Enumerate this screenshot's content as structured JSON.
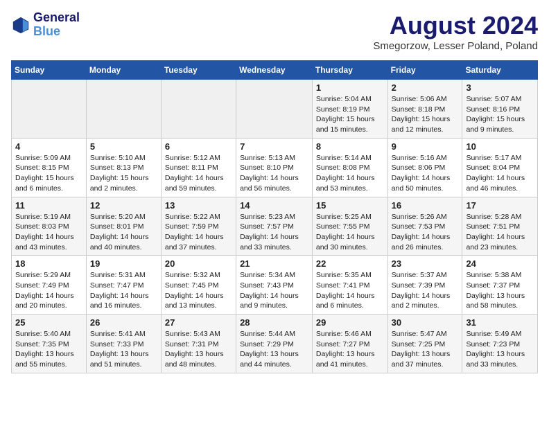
{
  "header": {
    "logo_line1": "General",
    "logo_line2": "Blue",
    "month_year": "August 2024",
    "location": "Smegorzow, Lesser Poland, Poland"
  },
  "days_of_week": [
    "Sunday",
    "Monday",
    "Tuesday",
    "Wednesday",
    "Thursday",
    "Friday",
    "Saturday"
  ],
  "weeks": [
    [
      {
        "day": "",
        "info": ""
      },
      {
        "day": "",
        "info": ""
      },
      {
        "day": "",
        "info": ""
      },
      {
        "day": "",
        "info": ""
      },
      {
        "day": "1",
        "info": "Sunrise: 5:04 AM\nSunset: 8:19 PM\nDaylight: 15 hours\nand 15 minutes."
      },
      {
        "day": "2",
        "info": "Sunrise: 5:06 AM\nSunset: 8:18 PM\nDaylight: 15 hours\nand 12 minutes."
      },
      {
        "day": "3",
        "info": "Sunrise: 5:07 AM\nSunset: 8:16 PM\nDaylight: 15 hours\nand 9 minutes."
      }
    ],
    [
      {
        "day": "4",
        "info": "Sunrise: 5:09 AM\nSunset: 8:15 PM\nDaylight: 15 hours\nand 6 minutes."
      },
      {
        "day": "5",
        "info": "Sunrise: 5:10 AM\nSunset: 8:13 PM\nDaylight: 15 hours\nand 2 minutes."
      },
      {
        "day": "6",
        "info": "Sunrise: 5:12 AM\nSunset: 8:11 PM\nDaylight: 14 hours\nand 59 minutes."
      },
      {
        "day": "7",
        "info": "Sunrise: 5:13 AM\nSunset: 8:10 PM\nDaylight: 14 hours\nand 56 minutes."
      },
      {
        "day": "8",
        "info": "Sunrise: 5:14 AM\nSunset: 8:08 PM\nDaylight: 14 hours\nand 53 minutes."
      },
      {
        "day": "9",
        "info": "Sunrise: 5:16 AM\nSunset: 8:06 PM\nDaylight: 14 hours\nand 50 minutes."
      },
      {
        "day": "10",
        "info": "Sunrise: 5:17 AM\nSunset: 8:04 PM\nDaylight: 14 hours\nand 46 minutes."
      }
    ],
    [
      {
        "day": "11",
        "info": "Sunrise: 5:19 AM\nSunset: 8:03 PM\nDaylight: 14 hours\nand 43 minutes."
      },
      {
        "day": "12",
        "info": "Sunrise: 5:20 AM\nSunset: 8:01 PM\nDaylight: 14 hours\nand 40 minutes."
      },
      {
        "day": "13",
        "info": "Sunrise: 5:22 AM\nSunset: 7:59 PM\nDaylight: 14 hours\nand 37 minutes."
      },
      {
        "day": "14",
        "info": "Sunrise: 5:23 AM\nSunset: 7:57 PM\nDaylight: 14 hours\nand 33 minutes."
      },
      {
        "day": "15",
        "info": "Sunrise: 5:25 AM\nSunset: 7:55 PM\nDaylight: 14 hours\nand 30 minutes."
      },
      {
        "day": "16",
        "info": "Sunrise: 5:26 AM\nSunset: 7:53 PM\nDaylight: 14 hours\nand 26 minutes."
      },
      {
        "day": "17",
        "info": "Sunrise: 5:28 AM\nSunset: 7:51 PM\nDaylight: 14 hours\nand 23 minutes."
      }
    ],
    [
      {
        "day": "18",
        "info": "Sunrise: 5:29 AM\nSunset: 7:49 PM\nDaylight: 14 hours\nand 20 minutes."
      },
      {
        "day": "19",
        "info": "Sunrise: 5:31 AM\nSunset: 7:47 PM\nDaylight: 14 hours\nand 16 minutes."
      },
      {
        "day": "20",
        "info": "Sunrise: 5:32 AM\nSunset: 7:45 PM\nDaylight: 14 hours\nand 13 minutes."
      },
      {
        "day": "21",
        "info": "Sunrise: 5:34 AM\nSunset: 7:43 PM\nDaylight: 14 hours\nand 9 minutes."
      },
      {
        "day": "22",
        "info": "Sunrise: 5:35 AM\nSunset: 7:41 PM\nDaylight: 14 hours\nand 6 minutes."
      },
      {
        "day": "23",
        "info": "Sunrise: 5:37 AM\nSunset: 7:39 PM\nDaylight: 14 hours\nand 2 minutes."
      },
      {
        "day": "24",
        "info": "Sunrise: 5:38 AM\nSunset: 7:37 PM\nDaylight: 13 hours\nand 58 minutes."
      }
    ],
    [
      {
        "day": "25",
        "info": "Sunrise: 5:40 AM\nSunset: 7:35 PM\nDaylight: 13 hours\nand 55 minutes."
      },
      {
        "day": "26",
        "info": "Sunrise: 5:41 AM\nSunset: 7:33 PM\nDaylight: 13 hours\nand 51 minutes."
      },
      {
        "day": "27",
        "info": "Sunrise: 5:43 AM\nSunset: 7:31 PM\nDaylight: 13 hours\nand 48 minutes."
      },
      {
        "day": "28",
        "info": "Sunrise: 5:44 AM\nSunset: 7:29 PM\nDaylight: 13 hours\nand 44 minutes."
      },
      {
        "day": "29",
        "info": "Sunrise: 5:46 AM\nSunset: 7:27 PM\nDaylight: 13 hours\nand 41 minutes."
      },
      {
        "day": "30",
        "info": "Sunrise: 5:47 AM\nSunset: 7:25 PM\nDaylight: 13 hours\nand 37 minutes."
      },
      {
        "day": "31",
        "info": "Sunrise: 5:49 AM\nSunset: 7:23 PM\nDaylight: 13 hours\nand 33 minutes."
      }
    ]
  ]
}
